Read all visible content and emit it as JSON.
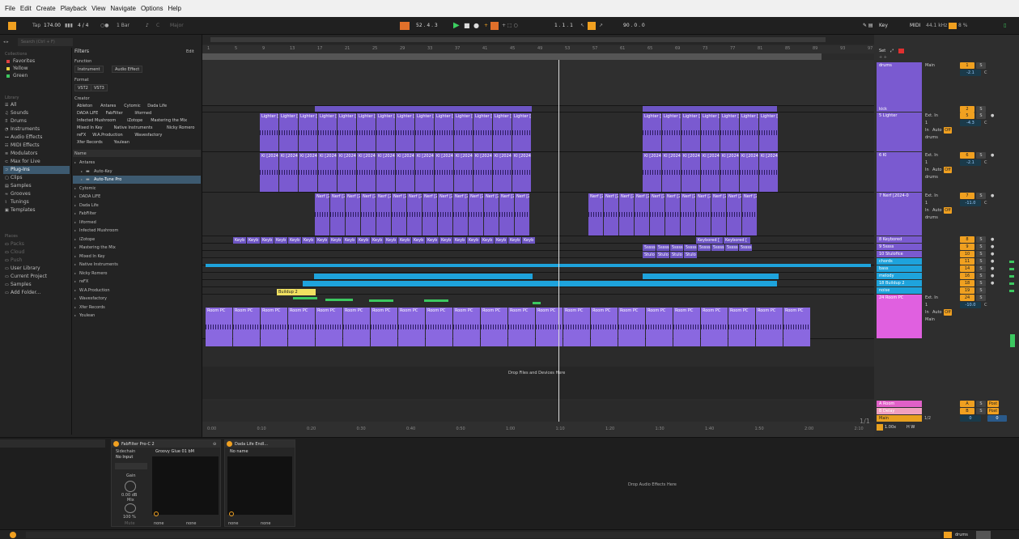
{
  "menu": [
    "File",
    "Edit",
    "Create",
    "Playback",
    "View",
    "Navigate",
    "Options",
    "Help"
  ],
  "transport": {
    "tap": "Tap",
    "tempo": "174.00",
    "sig": "4 / 4",
    "quant": "1 Bar",
    "key": "C",
    "scale": "Major",
    "position": "52 .  4 .  3",
    "loop_start": "1 .  1 .  1",
    "loop_len": "90 .  0 .  0",
    "key_btn": "Key",
    "midi_btn": "MIDI",
    "sample_rate": "44.1 kHz",
    "cpu": "8 %"
  },
  "browser": {
    "search_placeholder": "Search (Ctrl + F)",
    "collections_header": "Collections",
    "collections": [
      {
        "label": "Favorites",
        "color": "#e04040"
      },
      {
        "label": "Yellow",
        "color": "#e8d040"
      },
      {
        "label": "Green",
        "color": "#3cc860"
      }
    ],
    "library_header": "Library",
    "library": [
      "All",
      "Sounds",
      "Drums",
      "Instruments",
      "Audio Effects",
      "MIDI Effects",
      "Modulators",
      "Max for Live",
      "Plug-Ins",
      "Clips",
      "Samples",
      "Grooves",
      "Tunings",
      "Templates"
    ],
    "places_header": "Places",
    "places": [
      "Packs",
      "Cloud",
      "Push",
      "User Library",
      "Current Project",
      "Samples",
      "Add Folder..."
    ],
    "filters_label": "Filters",
    "edit_label": "Edit",
    "function_label": "Function",
    "function_chips": [
      "Instrument",
      "Audio Effect"
    ],
    "format_label": "Format",
    "format_chips": [
      "VST2",
      "VST3"
    ],
    "creator_label": "Creator",
    "creator_rows": [
      [
        "Ableton",
        "Antares",
        "Cytomic",
        "Dada Life"
      ],
      [
        "DADA LIFE",
        "FabFilter",
        "Iiformed"
      ],
      [
        "Infected Mushroom",
        "iZotope",
        "Mastering the Mix"
      ],
      [
        "Mixed In Key",
        "Native Instruments",
        "Nicky Romero"
      ],
      [
        "reFX",
        "W.A.Production",
        "Wavesfactory"
      ],
      [
        "Xfer Records",
        "Youlean"
      ]
    ],
    "name_header": "Name",
    "tree": [
      {
        "label": "Antares",
        "indent": 0
      },
      {
        "label": "Auto-Key",
        "indent": 2
      },
      {
        "label": "Auto-Tune Pro",
        "indent": 2
      },
      {
        "label": "Cytomic",
        "indent": 0
      },
      {
        "label": "DADA LIFE",
        "indent": 0
      },
      {
        "label": "Dada Life",
        "indent": 0
      },
      {
        "label": "FabFilter",
        "indent": 0
      },
      {
        "label": "Iiformed",
        "indent": 0
      },
      {
        "label": "Infected Mushroom",
        "indent": 0
      },
      {
        "label": "iZotope",
        "indent": 0
      },
      {
        "label": "Mastering the Mix",
        "indent": 0
      },
      {
        "label": "Mixed In Key",
        "indent": 0
      },
      {
        "label": "Native Instruments",
        "indent": 0
      },
      {
        "label": "Nicky Romero",
        "indent": 0
      },
      {
        "label": "reFX",
        "indent": 0
      },
      {
        "label": "W.A.Production",
        "indent": 0
      },
      {
        "label": "Wavesfactory",
        "indent": 0
      },
      {
        "label": "Xfer Records",
        "indent": 0
      },
      {
        "label": "Youlean",
        "indent": 0
      }
    ]
  },
  "arrangement": {
    "bars": [
      "1",
      "5",
      "9",
      "13",
      "17",
      "21",
      "25",
      "29",
      "33",
      "37",
      "41",
      "45",
      "49",
      "53",
      "57",
      "61",
      "65",
      "69",
      "73",
      "77",
      "81",
      "85",
      "89",
      "93",
      "97"
    ],
    "times": [
      "0:00",
      "0:10",
      "0:20",
      "0:30",
      "0:40",
      "0:50",
      "1:00",
      "1:10",
      "1:20",
      "1:30",
      "1:40",
      "1:50",
      "2:00",
      "2:10"
    ],
    "drop_text": "Drop Files and Devices Here",
    "page": "1/1",
    "clip_lighter": "Lighter [20",
    "clip_kl": "Kl [2024-06",
    "clip_nerf": "Nerf [2024-",
    "clip_keyb": "Keyb",
    "clip_keybored": "Keybored [",
    "clip_5": "5ssss",
    "clip_stulo": "Stulo",
    "clip_room": "Room PC",
    "clip_buildup": "Buildup 2"
  },
  "mixer": {
    "set": "Set",
    "tracks": [
      {
        "name": "drums",
        "num": "1",
        "color": "#7a5ad0"
      },
      {
        "name": "kick",
        "num": "2",
        "color": "#7a5ad0"
      },
      {
        "name": "5 Lighter",
        "num": "5",
        "color": "#7a5ad0"
      },
      {
        "name": "6 Kl",
        "num": "6",
        "color": "#7a5ad0"
      },
      {
        "name": "7 Nerf [2024-0",
        "num": "7",
        "color": "#7a5ad0"
      },
      {
        "name": "8 Keybored",
        "num": "8",
        "color": "#7a5ad0"
      },
      {
        "name": "9 5ssss",
        "num": "9",
        "color": "#7a5ad0"
      },
      {
        "name": "10 Stulofice",
        "num": "10",
        "color": "#7a5ad0"
      },
      {
        "name": "chords",
        "num": "11",
        "color": "#1ea3dc"
      },
      {
        "name": "bass",
        "num": "14",
        "color": "#1ea3dc"
      },
      {
        "name": "melody",
        "num": "16",
        "color": "#1ea3dc"
      },
      {
        "name": "18 Buildup 2",
        "num": "18",
        "color": "#1ea3dc"
      },
      {
        "name": "noise",
        "num": "19",
        "color": "#1ea3dc"
      },
      {
        "name": "24 Room PC",
        "num": "24",
        "color": "#e060e0"
      }
    ],
    "returns": [
      {
        "name": "A Room",
        "letter": "A",
        "color": "#e060c8"
      },
      {
        "name": "B Delay",
        "letter": "B",
        "color": "#f0a0c0"
      }
    ],
    "main": "Main",
    "main_sig": "1/2",
    "main_letter": "0",
    "ext_in": "Ext. In",
    "in_label": "In",
    "auto_label": "Auto",
    "off_label": "Off",
    "drums_route": "drums",
    "main_route": "Main",
    "s_label": "S",
    "c_label": "C",
    "vol_1": "-11.0",
    "vol_2": "-10.0",
    "vol_3": "-4.3",
    "vol_4": "-2.1",
    "zoom": "1.00x",
    "hw": "H W"
  },
  "devices": {
    "dev1_title": "FabFilter Pro-C 2",
    "dev1_preset": "Groovy Glue 01 bM",
    "sidechain": "Sidechain",
    "no_input": "No Input",
    "gain": "Gain",
    "gain_val": "0.00 dB",
    "mix": "Mix",
    "mix_val": "100 %",
    "mute": "Mute",
    "none": "none",
    "dev2_title": "Dada Life Endl...",
    "dev2_preset": "No name",
    "drop_text": "Drop Audio Effects Here"
  },
  "status": {
    "track": "drums"
  }
}
